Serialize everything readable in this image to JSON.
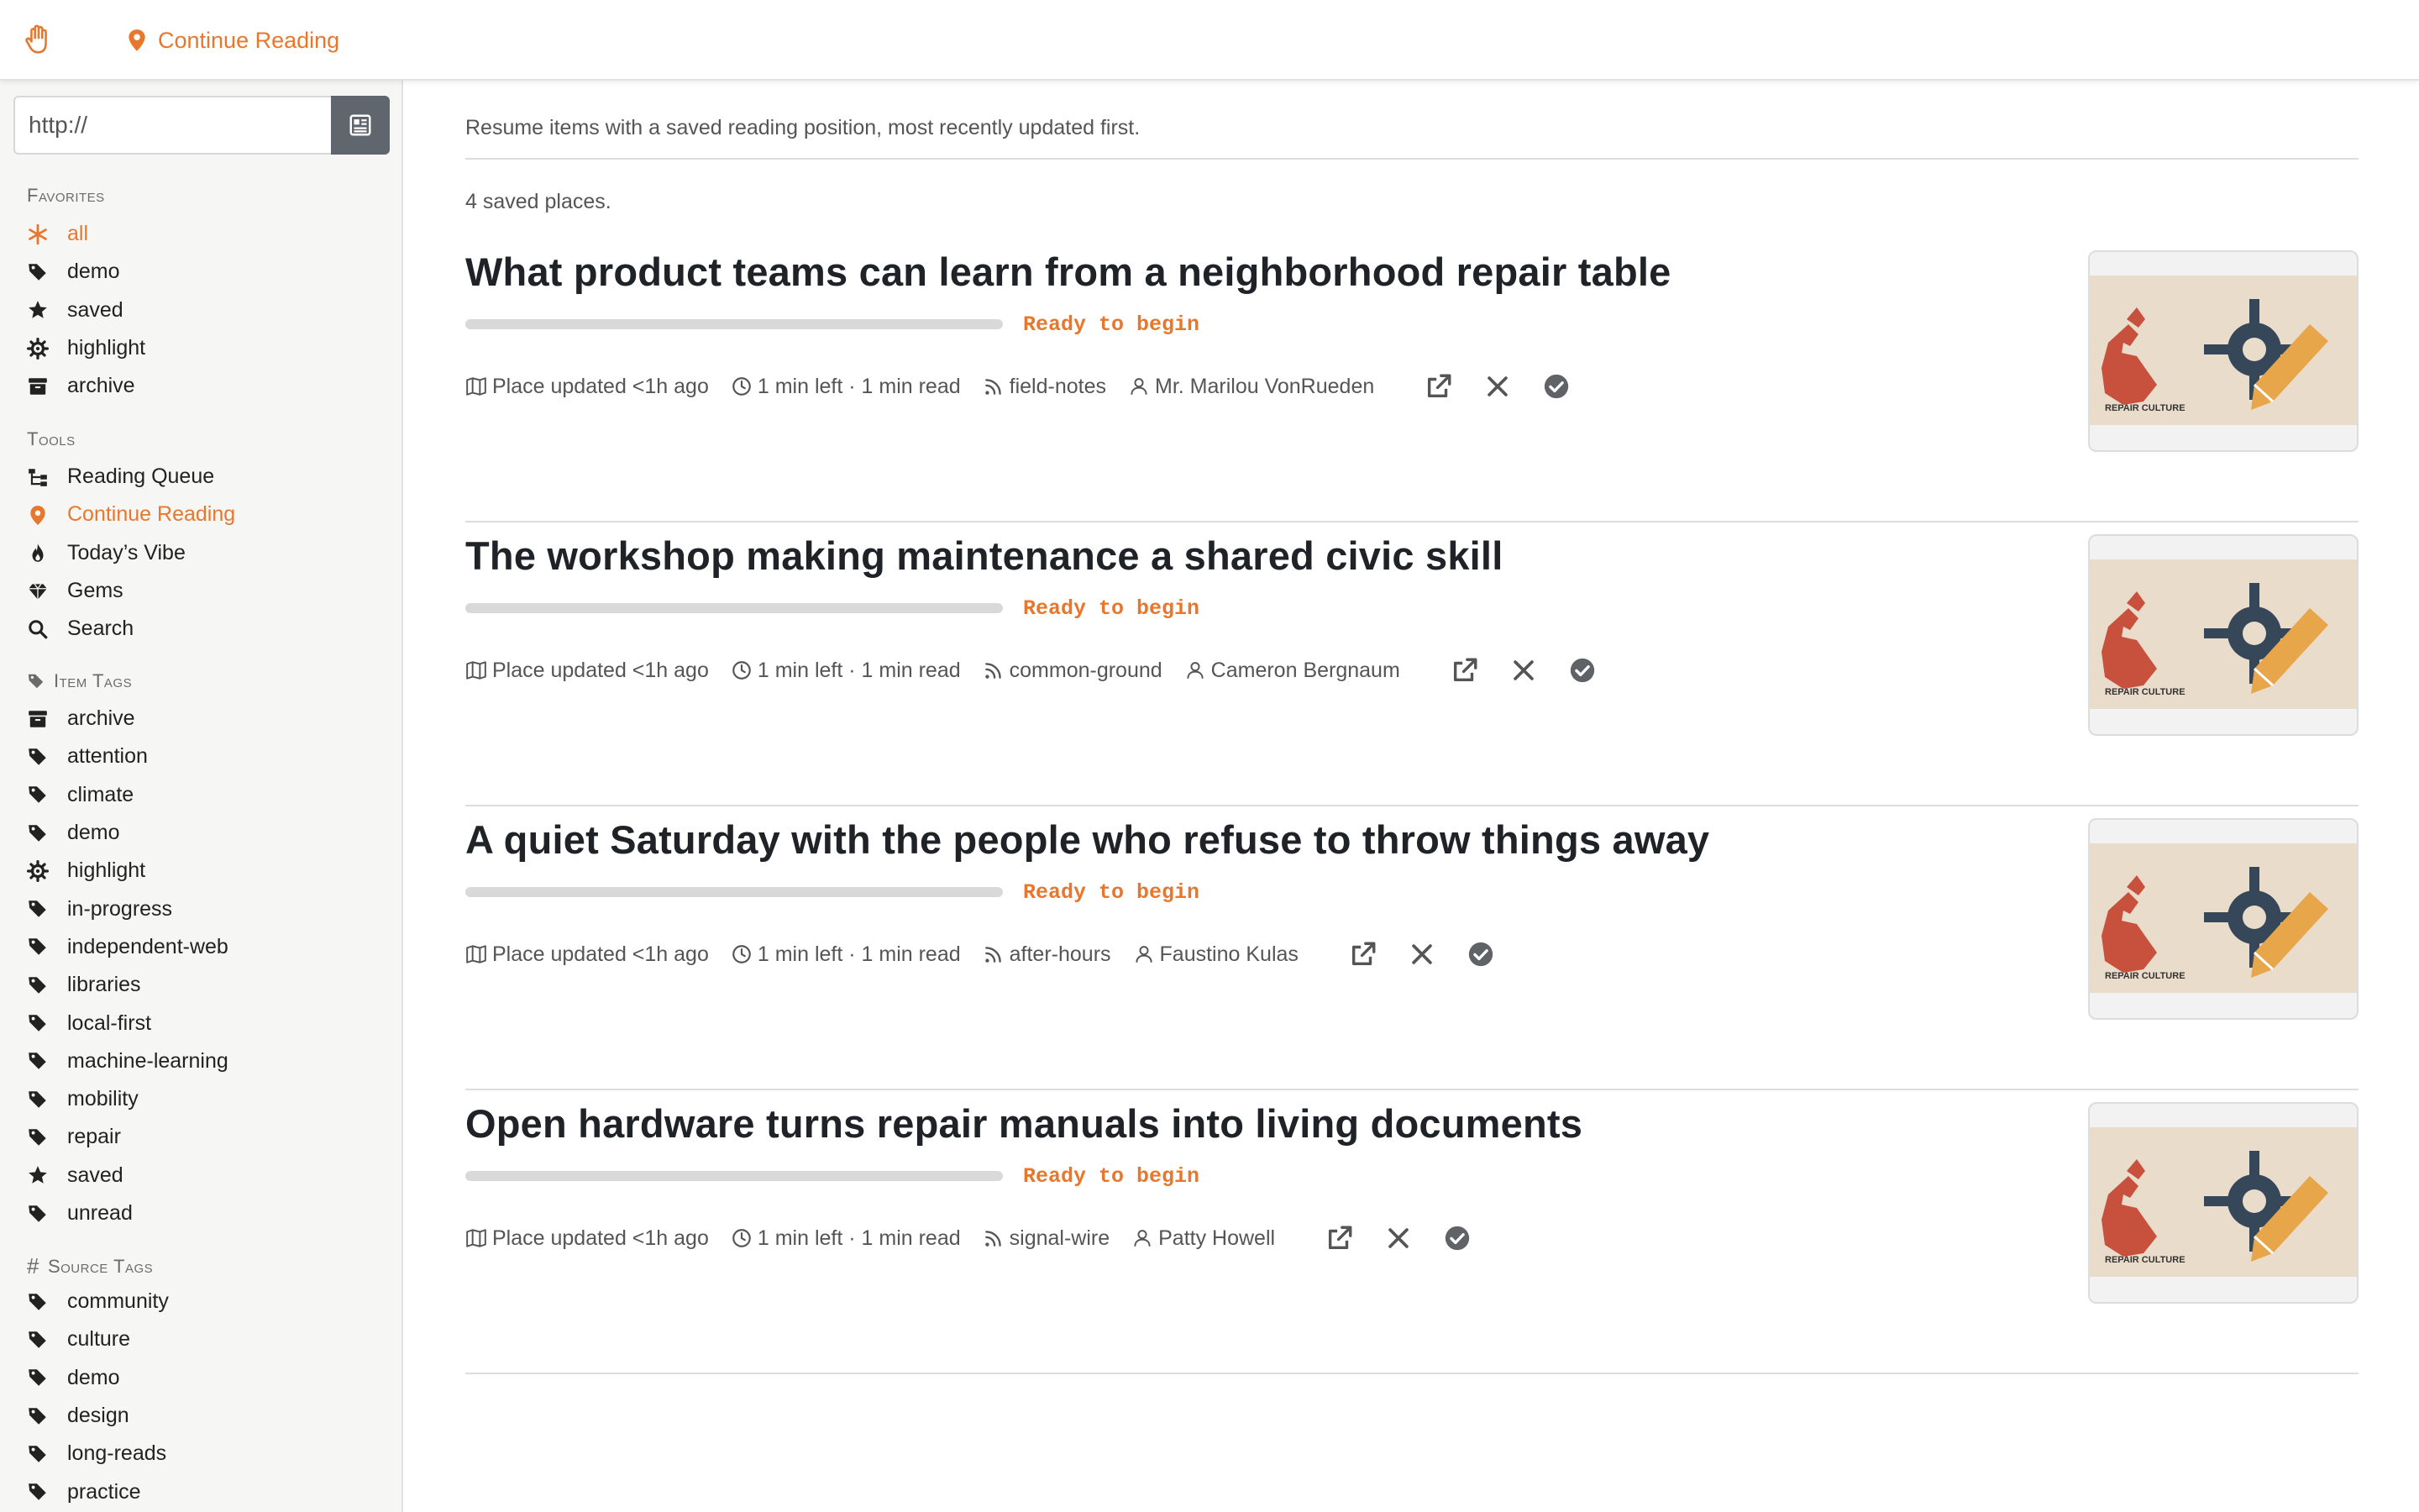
{
  "app": {
    "logo_icon": "hand-icon",
    "breadcrumb": "Continue Reading",
    "accent": "#e8772e"
  },
  "sidebar": {
    "url_placeholder": "http://",
    "favorites_label": "Favorites",
    "favorites": [
      {
        "label": "all",
        "icon": "asterisk-icon",
        "active": true
      },
      {
        "label": "demo",
        "icon": "tag-icon"
      },
      {
        "label": "saved",
        "icon": "star-icon"
      },
      {
        "label": "highlight",
        "icon": "gear-icon"
      },
      {
        "label": "archive",
        "icon": "archive-icon"
      }
    ],
    "tools_label": "Tools",
    "tools": [
      {
        "label": "Reading Queue",
        "icon": "sitemap-icon"
      },
      {
        "label": "Continue Reading",
        "icon": "location-pin-icon",
        "active": true
      },
      {
        "label": "Today’s Vibe",
        "icon": "fire-icon"
      },
      {
        "label": "Gems",
        "icon": "gem-icon"
      },
      {
        "label": "Search",
        "icon": "search-icon"
      }
    ],
    "item_tags_label": "Item Tags",
    "item_tags": [
      {
        "label": "archive",
        "icon": "archive-icon"
      },
      {
        "label": "attention",
        "icon": "tag-icon"
      },
      {
        "label": "climate",
        "icon": "tag-icon"
      },
      {
        "label": "demo",
        "icon": "tag-icon"
      },
      {
        "label": "highlight",
        "icon": "gear-icon"
      },
      {
        "label": "in-progress",
        "icon": "tag-icon"
      },
      {
        "label": "independent-web",
        "icon": "tag-icon"
      },
      {
        "label": "libraries",
        "icon": "tag-icon"
      },
      {
        "label": "local-first",
        "icon": "tag-icon"
      },
      {
        "label": "machine-learning",
        "icon": "tag-icon"
      },
      {
        "label": "mobility",
        "icon": "tag-icon"
      },
      {
        "label": "repair",
        "icon": "tag-icon"
      },
      {
        "label": "saved",
        "icon": "star-icon"
      },
      {
        "label": "unread",
        "icon": "tag-icon"
      }
    ],
    "source_tags_label": "Source Tags",
    "source_tags": [
      {
        "label": "community",
        "icon": "tag-icon"
      },
      {
        "label": "culture",
        "icon": "tag-icon"
      },
      {
        "label": "demo",
        "icon": "tag-icon"
      },
      {
        "label": "design",
        "icon": "tag-icon"
      },
      {
        "label": "long-reads",
        "icon": "tag-icon"
      },
      {
        "label": "practice",
        "icon": "tag-icon"
      }
    ]
  },
  "main": {
    "description": "Resume items with a saved reading position, most recently updated first.",
    "count": "4 saved places.",
    "items": [
      {
        "title": "What product teams can learn from a neighborhood repair table",
        "progress": 0,
        "status": "Ready to begin",
        "updated": "Place updated <1h ago",
        "time": "1 min left · 1 min read",
        "source": "field-notes",
        "author": "Mr. Marilou VonRueden",
        "thumb_caption": "REPAIR CULTURE"
      },
      {
        "title": "The workshop making maintenance a shared civic skill",
        "progress": 0,
        "status": "Ready to begin",
        "updated": "Place updated <1h ago",
        "time": "1 min left · 1 min read",
        "source": "common-ground",
        "author": "Cameron Bergnaum",
        "thumb_caption": "REPAIR CULTURE"
      },
      {
        "title": "A quiet Saturday with the people who refuse to throw things away",
        "progress": 0,
        "status": "Ready to begin",
        "updated": "Place updated <1h ago",
        "time": "1 min left · 1 min read",
        "source": "after-hours",
        "author": "Faustino Kulas",
        "thumb_caption": "REPAIR CULTURE"
      },
      {
        "title": "Open hardware turns repair manuals into living documents",
        "progress": 0,
        "status": "Ready to begin",
        "updated": "Place updated <1h ago",
        "time": "1 min left · 1 min read",
        "source": "signal-wire",
        "author": "Patty Howell",
        "thumb_caption": "REPAIR CULTURE"
      }
    ]
  }
}
